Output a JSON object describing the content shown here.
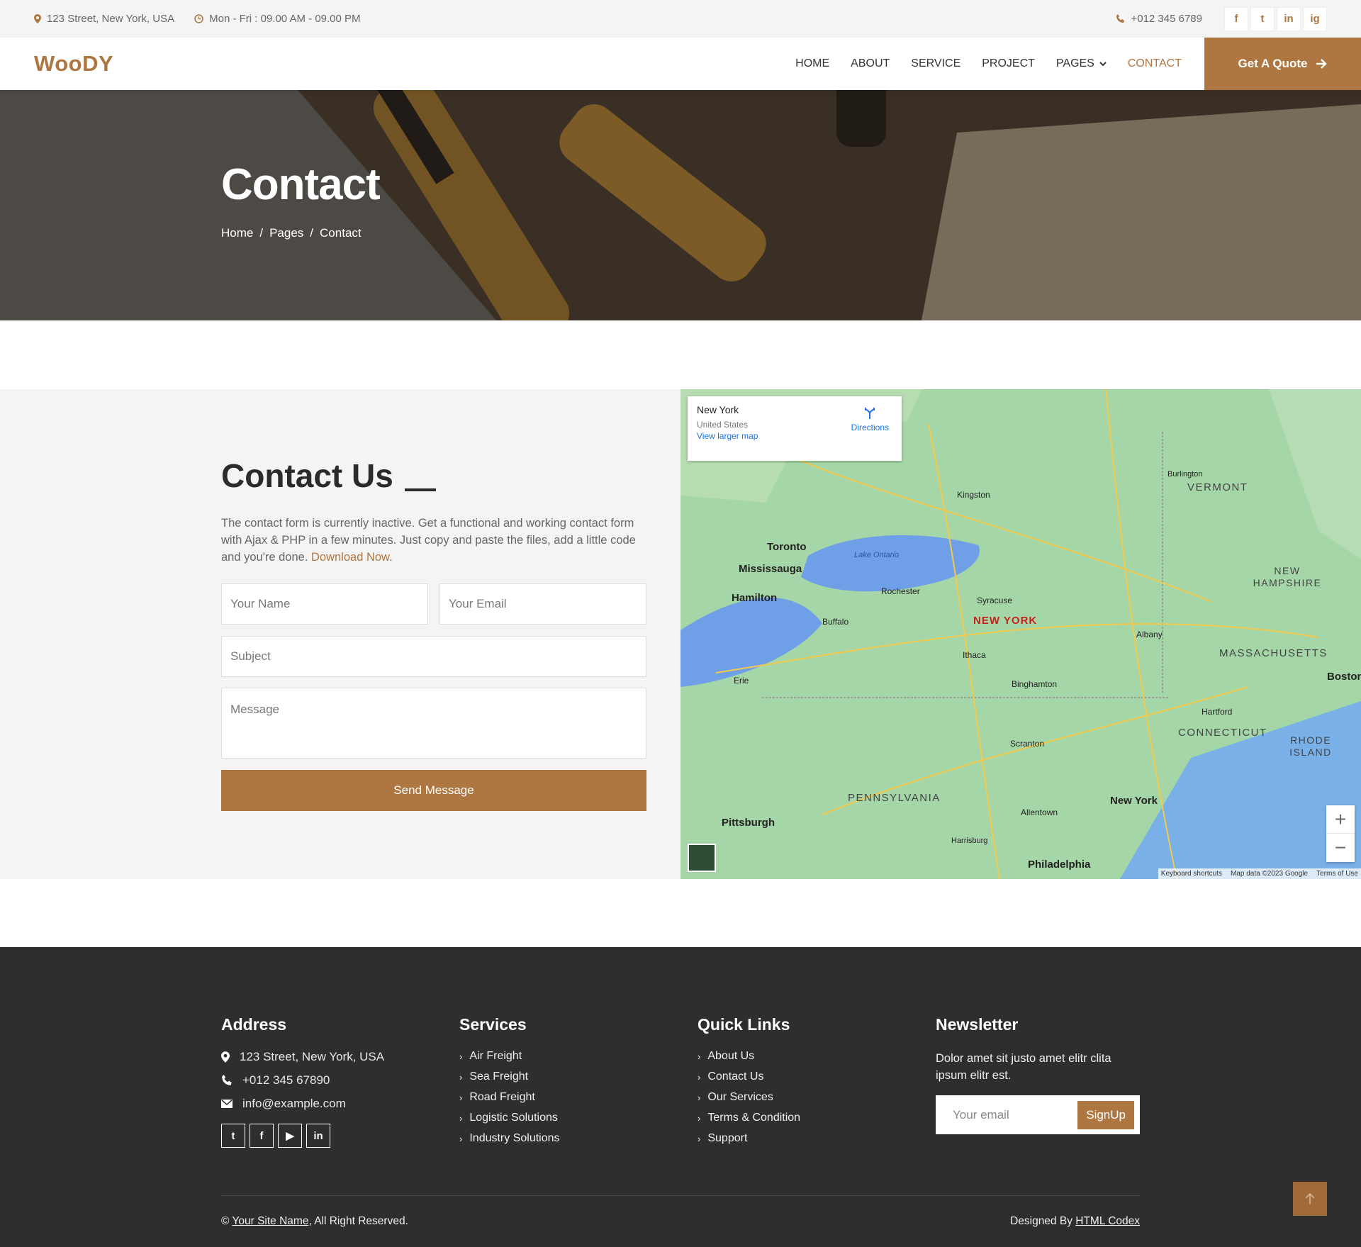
{
  "topbar": {
    "address": "123 Street, New York, USA",
    "hours": "Mon - Fri : 09.00 AM - 09.00 PM",
    "phone": "+012 345 6789",
    "social": [
      "f",
      "t",
      "in",
      "ig"
    ]
  },
  "navbar": {
    "logo": "WooDY",
    "items": [
      {
        "label": "HOME"
      },
      {
        "label": "ABOUT"
      },
      {
        "label": "SERVICE"
      },
      {
        "label": "PROJECT"
      },
      {
        "label": "PAGES"
      },
      {
        "label": "CONTACT"
      }
    ],
    "quote_label": "Get A Quote"
  },
  "hero": {
    "title": "Contact",
    "breadcrumb": [
      "Home",
      "Pages",
      "Contact"
    ]
  },
  "contact": {
    "heading": "Contact Us",
    "text_before": "The contact form is currently inactive. Get a functional and working contact form with Ajax & PHP in a few minutes. Just copy and paste the files, add a little code and you're done. ",
    "download_link": "Download Now",
    "text_after": ".",
    "name_placeholder": "Your Name",
    "email_placeholder": "Your Email",
    "subject_placeholder": "Subject",
    "message_placeholder": "Message",
    "send_label": "Send Message"
  },
  "map": {
    "place": "New York",
    "country": "United States",
    "directions": "Directions",
    "larger": "View larger map",
    "footer": [
      "Keyboard shortcuts",
      "Map data ©2023 Google",
      "Terms of Use"
    ],
    "labels": [
      "Toronto",
      "Mississauga",
      "Hamilton",
      "Buffalo",
      "Rochester",
      "Syracuse",
      "NEW YORK",
      "Albany",
      "Ithaca",
      "Binghamton",
      "Scranton",
      "PENNSYLVANIA",
      "Pittsburgh",
      "Allentown",
      "New York",
      "Philadelphia",
      "VERMONT",
      "NEW HAMPSHIRE",
      "MASSACHUSETTS",
      "Boston",
      "CONNECTICUT",
      "RHODE ISLAND",
      "Hartford",
      "Kingston",
      "Lake Ontario",
      "Burlington",
      "Erie",
      "Harrisburg"
    ]
  },
  "footer": {
    "address_title": "Address",
    "address": "123 Street, New York, USA",
    "phone": "+012 345 67890",
    "email": "info@example.com",
    "services_title": "Services",
    "services": [
      "Air Freight",
      "Sea Freight",
      "Road Freight",
      "Logistic Solutions",
      "Industry Solutions"
    ],
    "links_title": "Quick Links",
    "links": [
      "About Us",
      "Contact Us",
      "Our Services",
      "Terms & Condition",
      "Support"
    ],
    "newsletter_title": "Newsletter",
    "newsletter_text": "Dolor amet sit justo amet elitr clita ipsum elitr est.",
    "newsletter_placeholder": "Your email",
    "signup_label": "SignUp",
    "copyright_prefix": "© ",
    "site_name": "Your Site Name",
    "copyright_suffix": ", All Right Reserved.",
    "designed_prefix": "Designed By ",
    "designer": "HTML Codex"
  },
  "colors": {
    "accent": "#ae7640",
    "footer_bg": "#2e2e2e",
    "light_bg": "#f4f4f4"
  }
}
